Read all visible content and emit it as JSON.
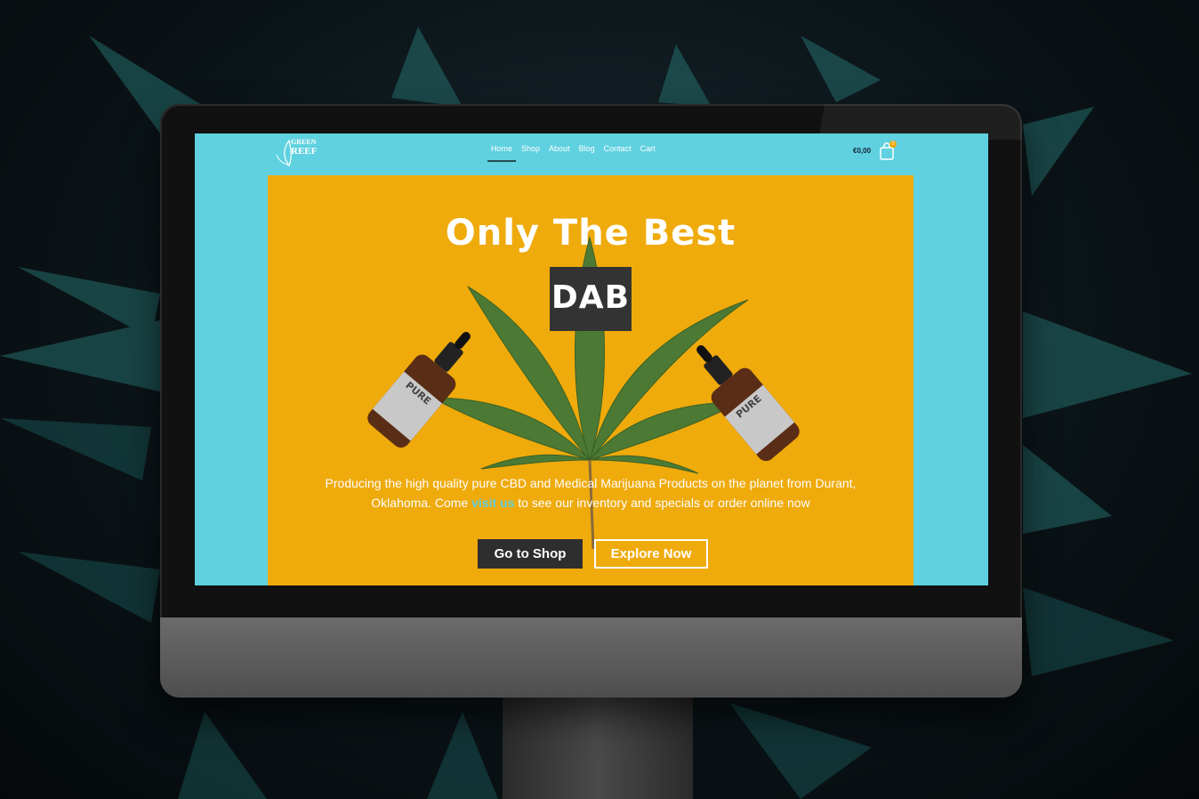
{
  "site": {
    "logo_alt": "Green Reef",
    "logo_line1": "GREEN",
    "logo_line2": "REEF"
  },
  "nav": {
    "items": [
      {
        "label": "Home",
        "active": true
      },
      {
        "label": "Shop",
        "active": false
      },
      {
        "label": "About",
        "active": false
      },
      {
        "label": "Blog",
        "active": false
      },
      {
        "label": "Contact",
        "active": false
      },
      {
        "label": "Cart",
        "active": false
      }
    ]
  },
  "cart": {
    "total": "€0,00",
    "count": "0",
    "icon": "shopping-bag-icon"
  },
  "hero": {
    "title": "Only The Best",
    "highlight": "DAB",
    "description_before": "Producing the high quality pure CBD and Medical Marijuana Products on the planet from Durant, Oklahoma. Come ",
    "description_link": "visit us",
    "description_after": " to see our inventory and specials or order online now",
    "bottle_label": "PURE",
    "buttons": {
      "shop": "Go to Shop",
      "explore": "Explore Now"
    }
  },
  "colors": {
    "screen_bg": "#5fd1e0",
    "hero_bg": "#efaa0b",
    "dark_button": "#2e2e2e",
    "link": "#5fd1e0"
  }
}
